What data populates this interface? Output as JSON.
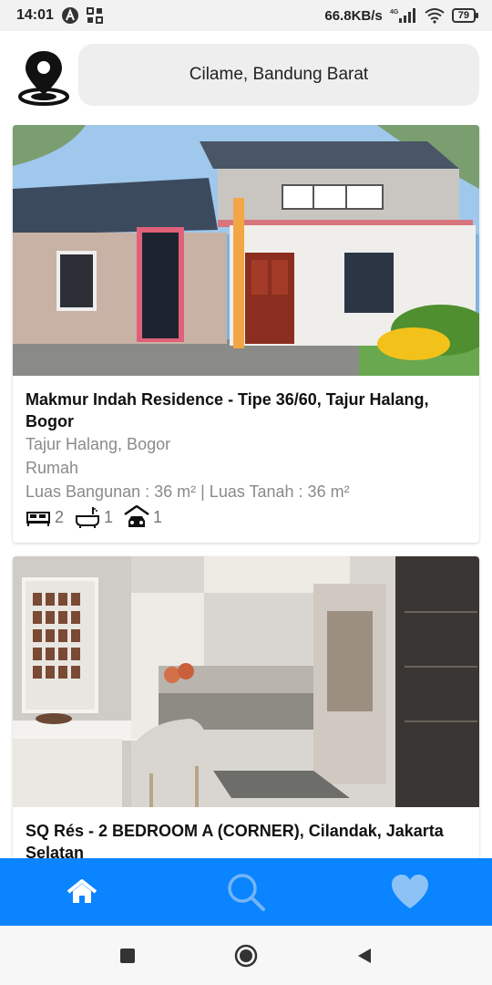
{
  "status_bar": {
    "time": "14:01",
    "net_speed": "66.8KB/s",
    "network_type": "4G",
    "battery": "79"
  },
  "header": {
    "location": "Cilame, Bandung Barat",
    "pin_icon": "location-pin-icon"
  },
  "listings": [
    {
      "title": "Makmur Indah Residence - Tipe 36/60, Tajur Halang, Bogor",
      "location": "Tajur Halang, Bogor",
      "type": "Rumah",
      "area": "Luas Bangunan : 36 m² | Luas Tanah : 36 m²",
      "bedrooms": "2",
      "bathrooms": "1",
      "garages": "1"
    },
    {
      "title": "SQ Rés - 2 BEDROOM A (CORNER), Cilandak, Jakarta Selatan"
    }
  ],
  "bottom_nav": {
    "items": [
      "home-icon",
      "search-icon",
      "heart-icon"
    ],
    "bg_color": "#0a84ff"
  }
}
